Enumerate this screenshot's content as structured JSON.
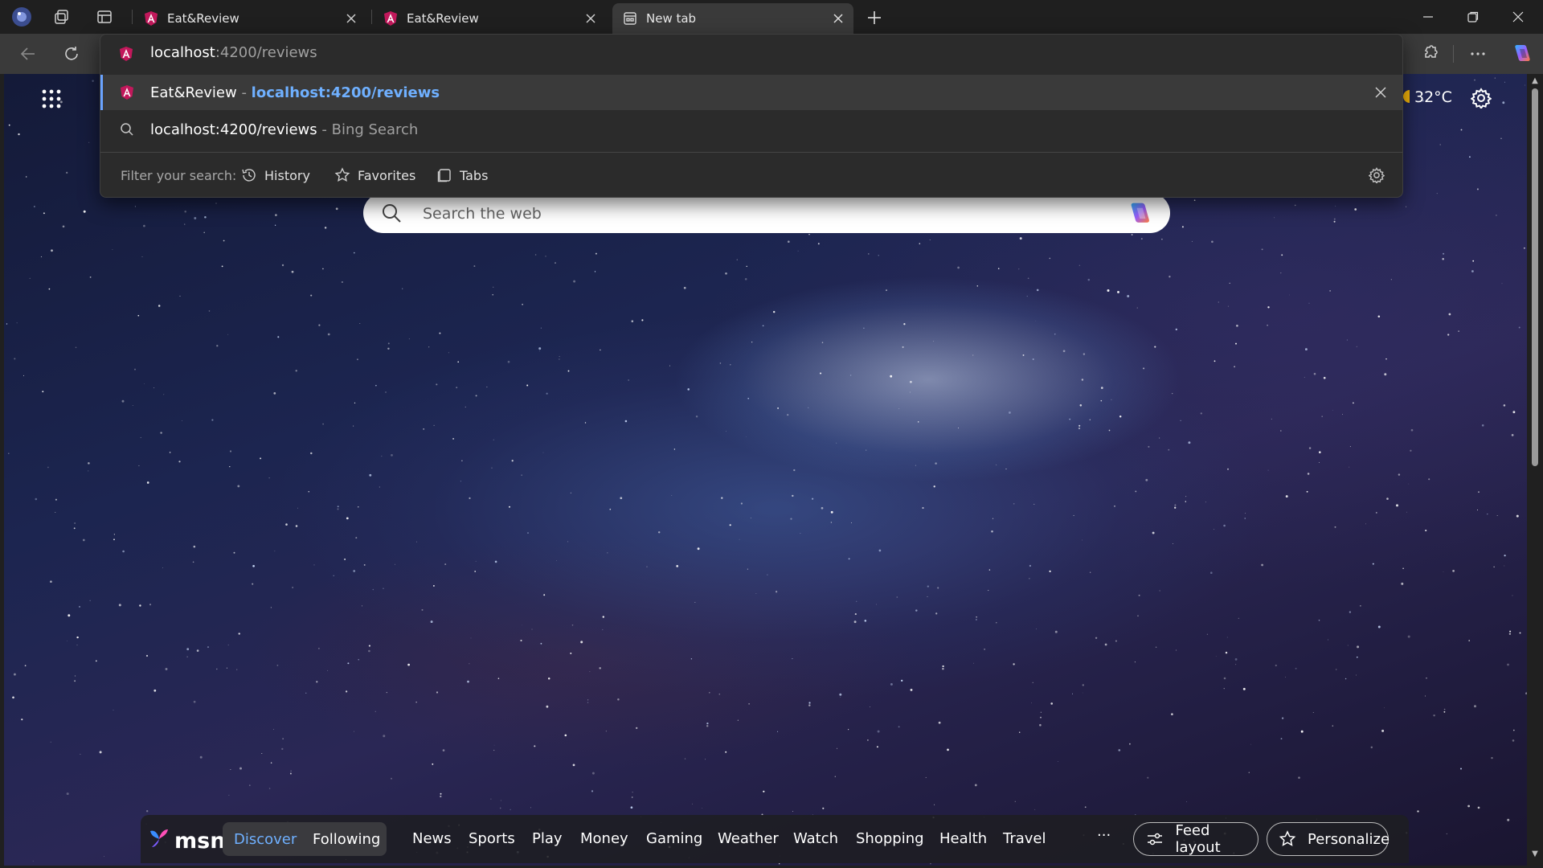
{
  "tabs": [
    {
      "title": "Eat&Review",
      "active": false
    },
    {
      "title": "Eat&Review",
      "active": false
    },
    {
      "title": "New tab",
      "active": true
    }
  ],
  "omnibox": {
    "typed_host": "localhost",
    "typed_rest": ":4200/reviews",
    "suggestions": [
      {
        "title": "Eat&Review",
        "separator": " - ",
        "url": "localhost:4200/reviews",
        "selected": true
      },
      {
        "query": "localhost:4200/reviews",
        "suffix": " - Bing Search",
        "selected": false
      }
    ],
    "filter": {
      "label": "Filter your search:",
      "history": "History",
      "favorites": "Favorites",
      "tabs": "Tabs"
    }
  },
  "newtab": {
    "weather": "32°C",
    "search_placeholder": "Search the web"
  },
  "msn": {
    "logo": "msn",
    "segments": [
      "Discover",
      "Following"
    ],
    "active_segment": "Discover",
    "nav": [
      "News",
      "Sports",
      "Play",
      "Money",
      "Gaming",
      "Weather",
      "Watch",
      "Shopping",
      "Health",
      "Travel"
    ],
    "more": "···",
    "feed_layout": "Feed layout",
    "personalize": "Personalize"
  },
  "colors": {
    "accent": "#6fb0ff",
    "tab_strip": "#1f1f1f",
    "toolbar": "#3a3a3a"
  }
}
